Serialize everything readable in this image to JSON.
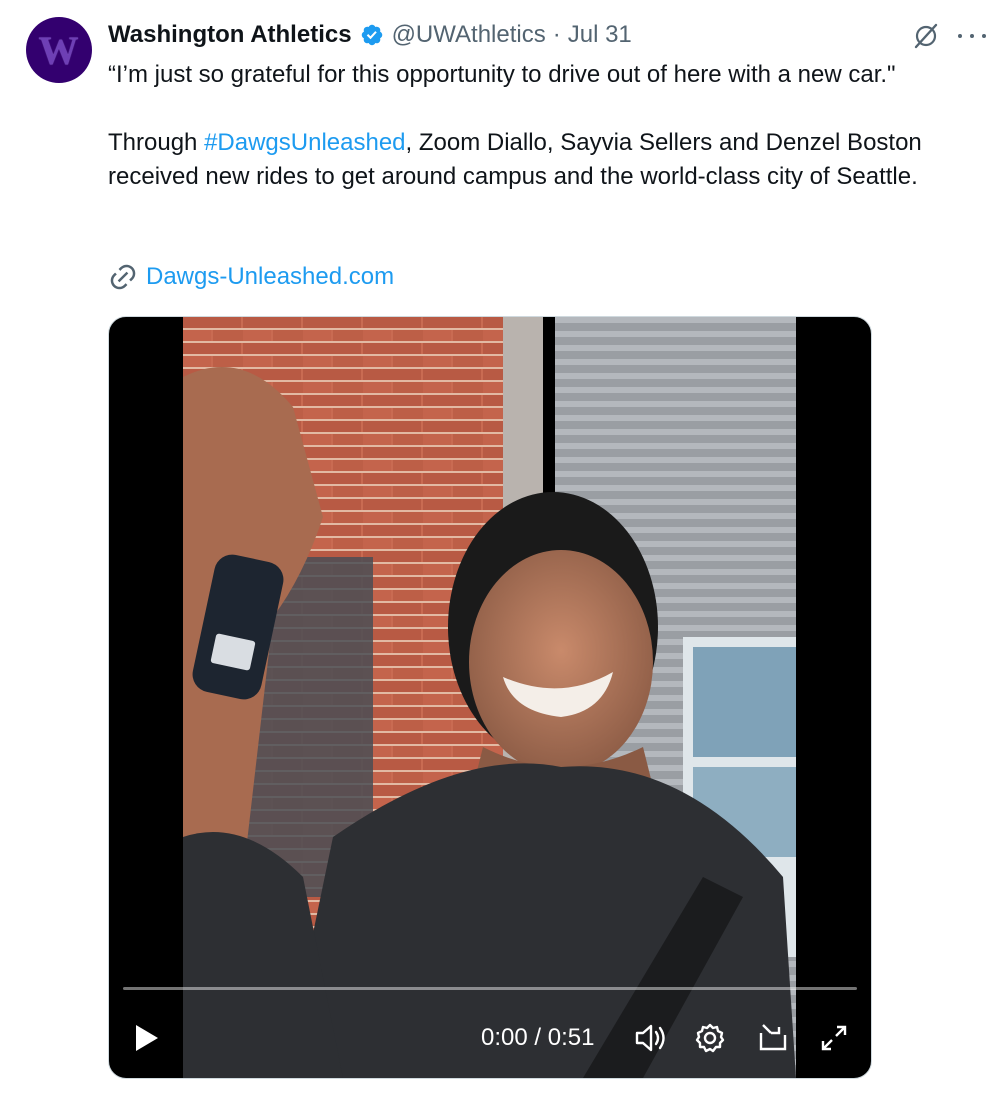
{
  "tweet": {
    "author_name": "Washington Athletics",
    "handle": "@UWAthletics",
    "separator": "·",
    "date": "Jul 31",
    "avatar_letter": "W",
    "text_line1": "“I’m just so grateful for this opportunity to drive out of here with a new car.\"",
    "text_p2_before": "Through ",
    "hashtag": "#DawgsUnleashed",
    "text_p2_after": ", Zoom Diallo, Sayvia Sellers and Denzel Boston received new rides to get around campus and the world-class city of Seattle.",
    "link_text": "Dawgs-Unleashed.com"
  },
  "video": {
    "current_time": "0:00",
    "time_separator": " / ",
    "duration": "0:51",
    "progress": 0.0
  },
  "icons": {
    "verified": "verified-badge-icon",
    "grok": "grok-icon",
    "more": "more-icon",
    "link": "link-icon",
    "play": "play-icon",
    "volume": "volume-icon",
    "settings": "gear-icon",
    "pip": "picture-in-picture-icon",
    "fullscreen": "fullscreen-icon"
  },
  "colors": {
    "accent": "#1d9bf0",
    "avatar_bg": "#33006f",
    "text": "#0f1419",
    "secondary_text": "#536471"
  }
}
